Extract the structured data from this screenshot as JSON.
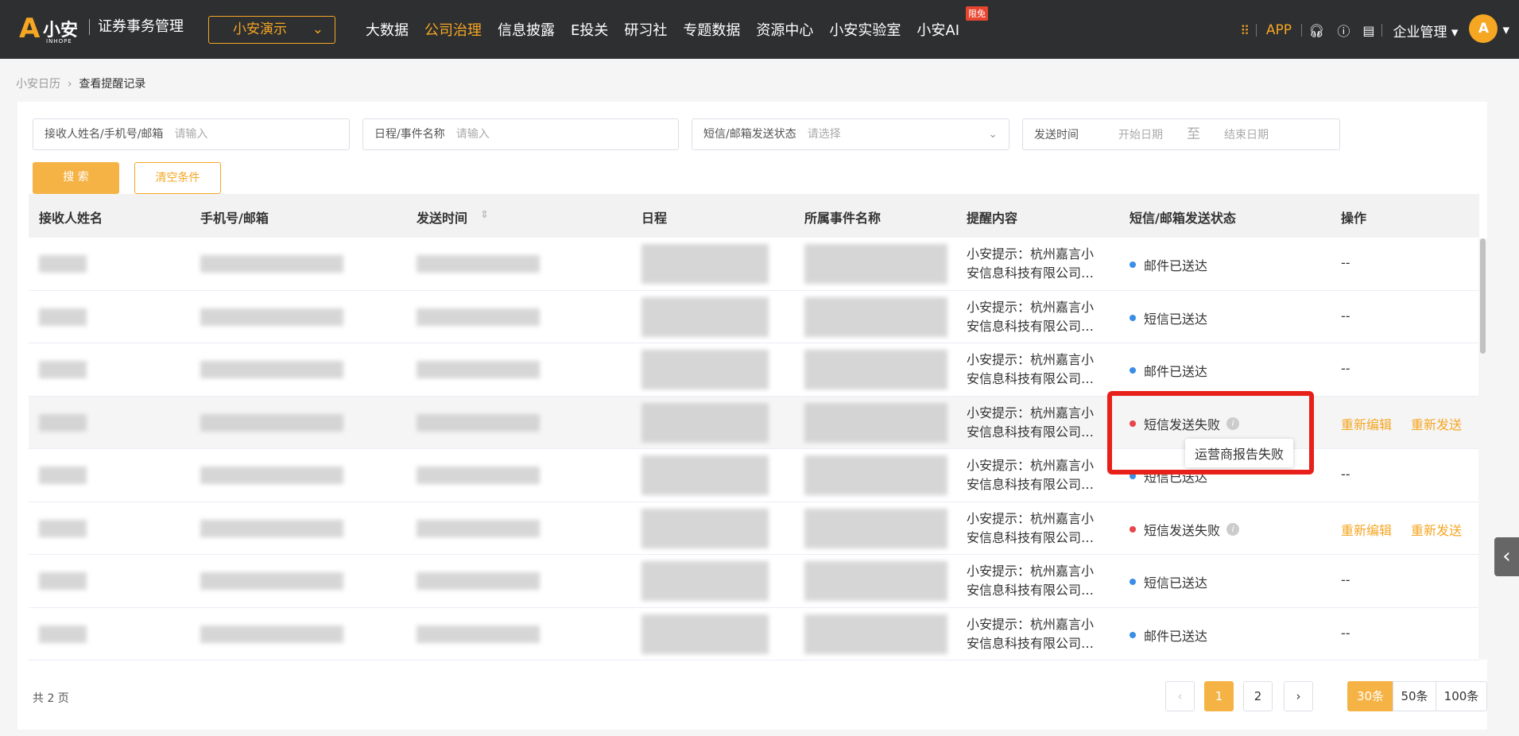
{
  "header": {
    "logo_text": "小安",
    "logo_sub": "INHOPE",
    "system": "证券事务管理",
    "org_select": "小安演示",
    "nav": [
      "大数据",
      "公司治理",
      "信息披露",
      "E投关",
      "研习社",
      "专题数据",
      "资源中心",
      "小安实验室",
      "小安AI"
    ],
    "nav_active": 1,
    "ai_badge": "限免",
    "app": "APP",
    "enterprise": "企业管理"
  },
  "breadcrumb": [
    "小安日历",
    "查看提醒记录"
  ],
  "filters": [
    {
      "label": "接收人姓名/手机号/邮箱",
      "placeholder": "请输入"
    },
    {
      "label": "日程/事件名称",
      "placeholder": "请输入"
    },
    {
      "label": "短信/邮箱发送状态",
      "placeholder": "请选择"
    },
    {
      "label": "发送时间",
      "start": "开始日期",
      "to": "至",
      "end": "结束日期"
    }
  ],
  "buttons": {
    "search": "搜 索",
    "clear": "清空条件"
  },
  "table": {
    "columns": [
      "接收人姓名",
      "手机号/邮箱",
      "发送时间",
      "日程",
      "所属事件名称",
      "提醒内容",
      "短信/邮箱发送状态",
      "操作"
    ],
    "rows": [
      {
        "content": "小安提示：杭州嘉言小安信息科技有限公司…",
        "status": "邮件已送达",
        "ok": true
      },
      {
        "content": "小安提示：杭州嘉言小安信息科技有限公司…",
        "status": "短信已送达",
        "ok": true
      },
      {
        "content": "小安提示：杭州嘉言小安信息科技有限公司…",
        "status": "邮件已送达",
        "ok": true
      },
      {
        "content": "小安提示：杭州嘉言小安信息科技有限公司…",
        "status": "短信发送失败",
        "ok": false
      },
      {
        "content": "小安提示：杭州嘉言小安信息科技有限公司…",
        "status": "短信已送达",
        "ok": true
      },
      {
        "content": "小安提示：杭州嘉言小安信息科技有限公司…",
        "status": "短信发送失败",
        "ok": false
      },
      {
        "content": "小安提示：杭州嘉言小安信息科技有限公司…",
        "status": "短信已送达",
        "ok": true
      },
      {
        "content": "小安提示：杭州嘉言小安信息科技有限公司…",
        "status": "邮件已送达",
        "ok": true
      }
    ],
    "no_action": "--",
    "edit": "重新编辑",
    "resend": "重新发送"
  },
  "tooltip": "运营商报告失败",
  "pagination": {
    "total": "共 2 页",
    "pages": [
      "1",
      "2"
    ],
    "current": "1",
    "sizes": [
      "30条",
      "50条",
      "100条"
    ],
    "size_active": "30条"
  },
  "colors": {
    "accent": "#f5a623",
    "ok": "#3a8ee6",
    "fail": "#e8454a",
    "highlight": "#e8201a"
  }
}
